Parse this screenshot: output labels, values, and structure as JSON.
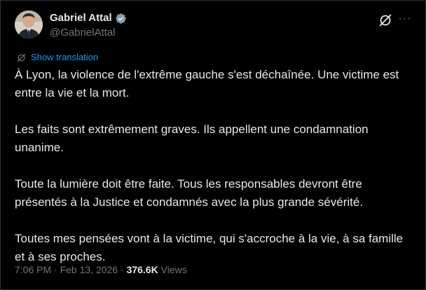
{
  "author": {
    "display_name": "Gabriel Attal",
    "handle": "@GabrielAttal",
    "verified_badge": "gray-verified-badge",
    "badge_color": "#829aab"
  },
  "actions": {
    "grok_icon": "grok-slash-circle-icon",
    "more_label": "···"
  },
  "translation": {
    "icon": "translate-icon",
    "link_label": "Show translation"
  },
  "tweet": {
    "paragraphs": [
      "À Lyon, la violence de l'extrême gauche s'est déchaînée. Une victime est entre la vie et la mort.",
      "Les faits sont extrêmement graves. Ils appellent une condamnation unanime.",
      "Toute la lumière doit être faite. Tous les responsables devront être présentés à la Justice et condamnés avec la plus grande sévérité.",
      "Toutes mes pensées vont à la victime, qui s'accroche à la vie, à sa famille et à ses proches."
    ]
  },
  "meta": {
    "time": "7:06 PM",
    "date_separator": "·",
    "date": "Feb 13, 2026",
    "views_separator": "·",
    "views_count": "376.6K",
    "views_label": "Views"
  },
  "colors": {
    "background": "#000000",
    "text_primary": "#e7e9ea",
    "text_secondary": "#71767b",
    "link": "#1d9bf0",
    "border": "#2f3336"
  }
}
